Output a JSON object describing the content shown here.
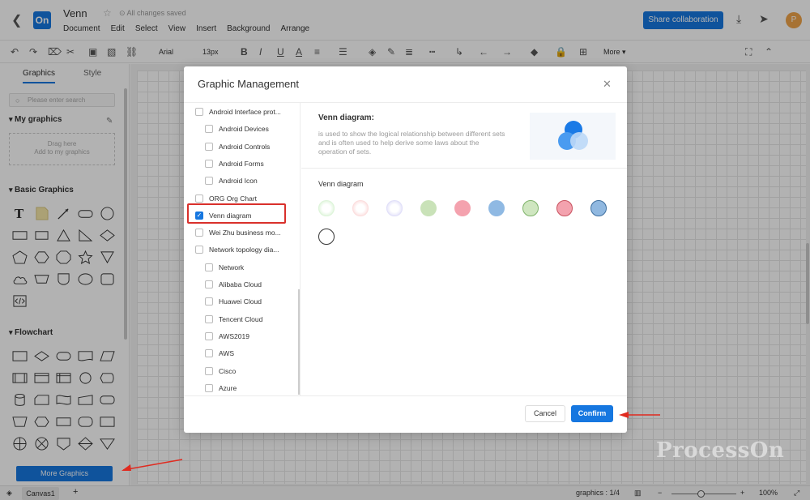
{
  "header": {
    "logo": "On",
    "doc_title": "Venn",
    "save_status": "All changes saved",
    "menu": [
      "Document",
      "Edit",
      "Select",
      "View",
      "Insert",
      "Background",
      "Arrange"
    ],
    "share_label": "Share collaboration",
    "avatar_letter": "P"
  },
  "toolbar": {
    "font": "Arial",
    "font_size": "13px",
    "more_label": "More"
  },
  "sidebar": {
    "tabs": [
      "Graphics",
      "Style"
    ],
    "search_placeholder": "Please enter search",
    "my_graphics_title": "My graphics",
    "drop_hint_line1": "Drag here",
    "drop_hint_line2": "Add to my graphics",
    "basic_title": "Basic Graphics",
    "flowchart_title": "Flowchart",
    "more_button": "More Graphics"
  },
  "modal": {
    "title": "Graphic Management",
    "tree": [
      {
        "label": "Android Interface prot...",
        "checked": false,
        "indent": 0
      },
      {
        "label": "Android Devices",
        "checked": false,
        "indent": 1
      },
      {
        "label": "Android Controls",
        "checked": false,
        "indent": 1
      },
      {
        "label": "Android Forms",
        "checked": false,
        "indent": 1
      },
      {
        "label": "Android Icon",
        "checked": false,
        "indent": 1
      },
      {
        "label": "ORG Org Chart",
        "checked": false,
        "indent": 0
      },
      {
        "label": "Venn diagram",
        "checked": true,
        "indent": 0
      },
      {
        "label": "Wei Zhu business mo...",
        "checked": false,
        "indent": 0
      },
      {
        "label": "Network topology dia...",
        "checked": false,
        "indent": 0
      },
      {
        "label": "Network",
        "checked": false,
        "indent": 1
      },
      {
        "label": "Alibaba Cloud",
        "checked": false,
        "indent": 1
      },
      {
        "label": "Huawei Cloud",
        "checked": false,
        "indent": 1
      },
      {
        "label": "Tencent Cloud",
        "checked": false,
        "indent": 1
      },
      {
        "label": "AWS2019",
        "checked": false,
        "indent": 1
      },
      {
        "label": "AWS",
        "checked": false,
        "indent": 1
      },
      {
        "label": "Cisco",
        "checked": false,
        "indent": 1
      },
      {
        "label": "Azure",
        "checked": false,
        "indent": 1
      }
    ],
    "detail_title": "Venn diagram:",
    "detail_desc": "is used to show the logical relationship between different sets and is often used to help derive some laws about the operation of sets.",
    "section_label": "Venn diagram",
    "swatches": [
      {
        "fill": "#e9f8e6",
        "ring": "#9ddf94",
        "style": "glow"
      },
      {
        "fill": "#fde9e9",
        "ring": "#f3a3a3",
        "style": "glow"
      },
      {
        "fill": "#ecebfb",
        "ring": "#a6a1ec",
        "style": "glow"
      },
      {
        "fill": "#c9e2b8",
        "ring": "#c9e2b8",
        "style": "solid"
      },
      {
        "fill": "#f4a2ae",
        "ring": "#f4a2ae",
        "style": "solid"
      },
      {
        "fill": "#8fb9e3",
        "ring": "#8fb9e3",
        "style": "solid"
      },
      {
        "fill": "#cfe6c0",
        "ring": "#7fb36a",
        "style": "outline"
      },
      {
        "fill": "#f3a2ae",
        "ring": "#c9525f",
        "style": "outline"
      },
      {
        "fill": "#90b8e0",
        "ring": "#3e6f9f",
        "style": "outline"
      },
      {
        "fill": "#ffffff",
        "ring": "#333333",
        "style": "outline"
      }
    ],
    "cancel_label": "Cancel",
    "confirm_label": "Confirm"
  },
  "status_bar": {
    "canvas_tab": "Canvas1",
    "graphics_count": "graphics : 1/4",
    "zoom": "100%"
  },
  "watermark": "ProcessOn",
  "colors": {
    "accent": "#1677e0",
    "highlight": "#d9302b"
  }
}
